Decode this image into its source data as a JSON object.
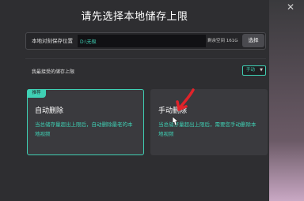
{
  "dialog": {
    "title": "请先选择本地储存上限",
    "close_icon": "✕"
  },
  "storage_path": {
    "label": "本地对刻保存位置",
    "value": "D:\\无极",
    "free_space": "剩余空间 161G",
    "choose_button": "选择"
  },
  "policy": {
    "label": "我最接受的储存上限",
    "selected": "手动"
  },
  "cards": {
    "auto": {
      "badge": "推荐",
      "title": "自动删除",
      "desc_line1": "当总储存量超出上限后，自动删除最老的本",
      "desc_line2": "地视频"
    },
    "manual": {
      "title": "手动删除",
      "desc_line1": "当总储存量超出上限后，需要您手动删除本",
      "desc_line2": "地视频"
    }
  },
  "colors": {
    "accent": "#3fd0b4",
    "annotation": "#e0232a",
    "background": "#2e2e31"
  },
  "icons": [
    "close-icon",
    "chevron-down-icon",
    "cursor-icon",
    "red-arrow-annotation-icon"
  ]
}
